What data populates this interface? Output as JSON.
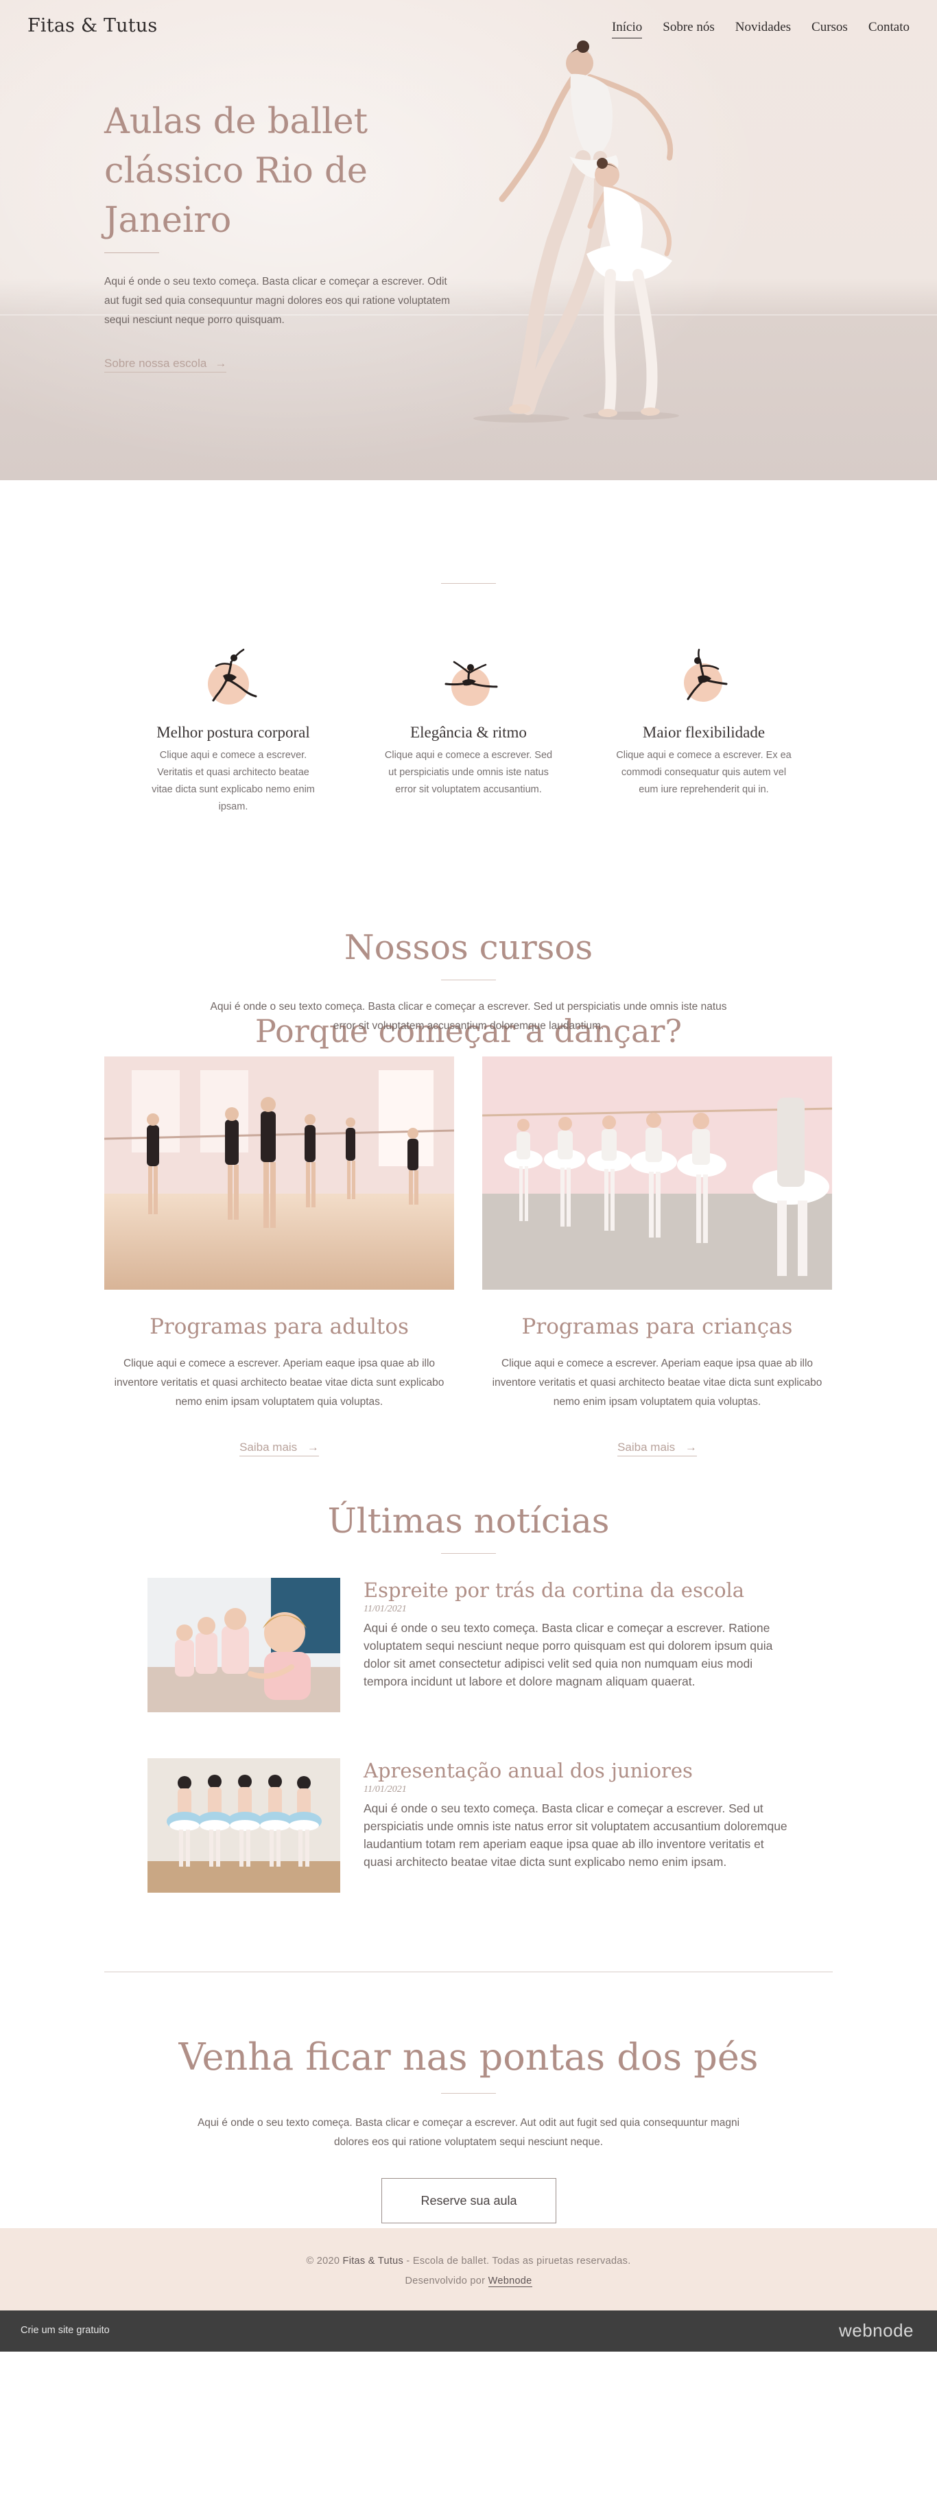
{
  "header": {
    "logo": "Fitas & Tutus",
    "nav": [
      "Início",
      "Sobre nós",
      "Novidades",
      "Cursos",
      "Contato"
    ]
  },
  "hero": {
    "title": "Aulas de ballet clássico Rio de Janeiro",
    "description": "Aqui é onde o seu texto começa. Basta clicar e começar a escrever. Odit aut fugit sed quia consequuntur magni dolores eos qui ratione voluptatem sequi nesciunt neque porro quisquam.",
    "link": "Sobre nossa escola",
    "link_arrow": "→"
  },
  "why": {
    "title": "Porque começar a dançar?",
    "features": [
      {
        "icon": "ballerina-leap-icon",
        "title": "Melhor postura corporal",
        "text": "Clique aqui e comece a escrever. Veritatis et quasi architecto beatae vitae dicta sunt explicabo nemo enim ipsam."
      },
      {
        "icon": "ballerina-leap-icon",
        "title": "Elegância & ritmo",
        "text": "Clique aqui e comece a escrever. Sed ut perspiciatis unde omnis iste natus error sit voluptatem accusantium."
      },
      {
        "icon": "ballerina-leap-icon",
        "title": "Maior flexibilidade",
        "text": "Clique aqui e comece a escrever. Ex ea commodi consequatur quis autem vel eum iure reprehenderit qui in."
      }
    ]
  },
  "courses": {
    "title": "Nossos cursos",
    "description": "Aqui é onde o seu texto começa. Basta clicar e começar a escrever. Sed ut perspiciatis unde omnis iste natus error sit voluptatem accusantium doloremque laudantium.",
    "items": [
      {
        "title": "Programas para adultos",
        "text": "Clique aqui e comece a escrever. Aperiam eaque ipsa quae ab illo inventore veritatis et quasi architecto beatae vitae dicta sunt explicabo nemo enim ipsam voluptatem quia voluptas.",
        "link": "Saiba mais"
      },
      {
        "title": "Programas para crianças",
        "text": "Clique aqui e comece a escrever. Aperiam eaque ipsa quae ab illo inventore veritatis et quasi architecto beatae vitae dicta sunt explicabo nemo enim ipsam voluptatem quia voluptas.",
        "link": "Saiba mais"
      }
    ],
    "link_arrow": "→"
  },
  "news": {
    "title": "Últimas notícias",
    "posts": [
      {
        "title": "Espreite por trás da cortina da escola",
        "date": "11/01/2021",
        "text": "Aqui é onde o seu texto começa. Basta clicar e começar a escrever. Ratione voluptatem sequi nesciunt neque porro quisquam est qui dolorem ipsum quia dolor sit amet consectetur adipisci velit sed quia non numquam eius modi tempora incidunt ut labore et dolore magnam aliquam quaerat."
      },
      {
        "title": "Apresentação anual dos juniores",
        "date": "11/01/2021",
        "text": "Aqui é onde o seu texto começa. Basta clicar e começar a escrever. Sed ut perspiciatis unde omnis iste natus error sit voluptatem accusantium doloremque laudantium totam rem aperiam eaque ipsa quae ab illo inventore veritatis et quasi architecto beatae vitae dicta sunt explicabo nemo enim ipsam."
      }
    ]
  },
  "cta": {
    "title": "Venha ficar nas pontas dos pés",
    "description": "Aqui é onde o seu texto começa. Basta clicar e começar a escrever. Aut odit aut fugit sed quia consequuntur magni dolores eos qui ratione voluptatem sequi nesciunt neque.",
    "button": "Reserve sua aula"
  },
  "footer": {
    "copyright_prefix": "© 2020 ",
    "brand": "Fitas & Tutus",
    "copyright_suffix": " - Escola de ballet. Todas as pirueta‍s reservadas.",
    "developed_by": "Desenvolvido por ",
    "developer": "Webnode"
  },
  "webnode_bar": {
    "free_site": "Crie um site gratuito",
    "brand": "webnode"
  },
  "colors": {
    "accent": "#b08f87",
    "hero_bg": "#efe6e1",
    "footer_bg": "#f4e7df",
    "icon_circle": "#f3cdb8",
    "bar_bg": "#3f3f3f"
  }
}
